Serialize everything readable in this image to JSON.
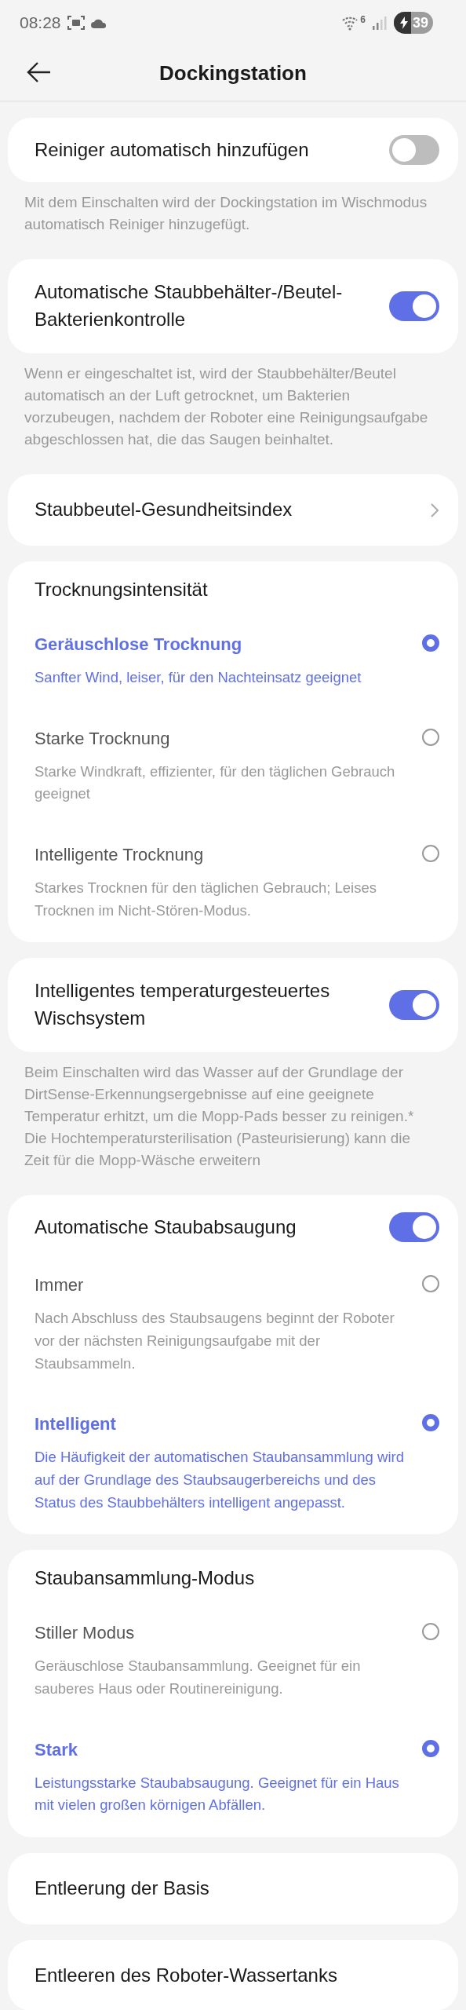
{
  "status_bar": {
    "time": "08:28",
    "wifi_badge": "6",
    "battery": "39"
  },
  "header": {
    "title": "Dockingstation"
  },
  "sections": [
    {
      "kind": "toggle",
      "title": "Reiniger automatisch hinzufügen",
      "on": false,
      "note": "Mit dem Einschalten wird der Dockingstation im Wischmodus automatisch Reiniger hinzugefügt."
    },
    {
      "kind": "toggle",
      "title": "Automatische Staubbehälter-/Beutel-Bakterienkontrolle",
      "on": true,
      "note": "Wenn er eingeschaltet ist, wird der Staubbehälter/Beutel automatisch an der Luft getrocknet, um Bakterien vorzubeugen, nachdem der Roboter eine Reinigungsaufgabe abgeschlossen hat, die das Saugen beinhaltet."
    },
    {
      "kind": "link",
      "title": "Staubbeutel-Gesundheitsindex"
    },
    {
      "kind": "choice",
      "title": "Trocknungsintensität",
      "options": [
        {
          "title": "Geräuschlose Trocknung",
          "description": "Sanfter Wind, leiser, für den Nachteinsatz geeignet",
          "selected": true
        },
        {
          "title": "Starke Trocknung",
          "description": "Starke Windkraft, effizienter, für den täglichen Gebrauch geeignet",
          "selected": false
        },
        {
          "title": "Intelligente Trocknung",
          "description": "Starkes Trocknen für den täglichen Gebrauch; Leises Trocknen im Nicht-Stören-Modus.",
          "selected": false
        }
      ]
    },
    {
      "kind": "toggle",
      "title": "Intelligentes temperaturgesteuertes Wischsystem",
      "on": true,
      "note": "Beim Einschalten wird das Wasser auf der Grundlage der DirtSense-Erkennungsergebnisse auf eine geeignete Temperatur erhitzt, um die Mopp-Pads besser zu reinigen.* Die Hochtemperatursterilisation (Pasteurisierung) kann die Zeit für die Mopp-Wäsche erweitern"
    },
    {
      "kind": "toggle",
      "title": "Automatische Staubabsaugung",
      "on": true,
      "options": [
        {
          "title": "Immer",
          "description": "Nach Abschluss des Staubsaugens beginnt der Roboter vor der nächsten Reinigungsaufgabe mit der Staubsammeln.",
          "selected": false
        },
        {
          "title": "Intelligent",
          "description": "Die Häufigkeit der automatischen Staubansammlung wird auf der Grundlage des Staubsaugerbereichs und des Status des Staubbehälters intelligent angepasst.",
          "selected": true
        }
      ]
    },
    {
      "kind": "choice",
      "title": "Staubansammlung-Modus",
      "options": [
        {
          "title": "Stiller Modus",
          "description": "Geräuschlose Staubansammlung. Geeignet für ein sauberes Haus oder Routinereinigung.",
          "selected": false
        },
        {
          "title": "Stark",
          "description": "Leistungsstarke Staubabsaugung. Geeignet für ein Haus mit vielen großen körnigen Abfällen.",
          "selected": true
        }
      ]
    },
    {
      "kind": "plain",
      "title": "Entleerung der Basis"
    },
    {
      "kind": "plain",
      "title": "Entleeren des Roboter-Wassertanks"
    }
  ]
}
